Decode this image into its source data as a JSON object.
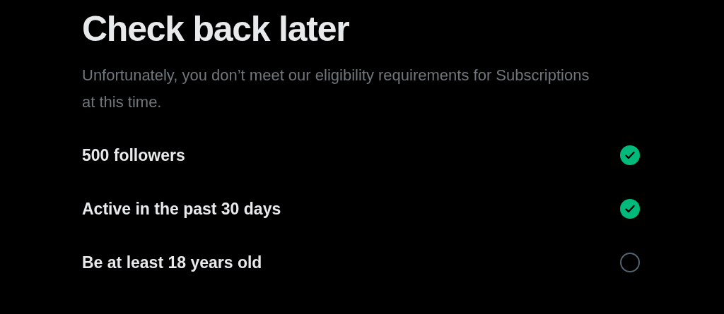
{
  "title": "Check back later",
  "description": "Unfortunately, you don’t meet our eligibility requirements for Subscriptions at this time.",
  "requirements": [
    {
      "label": "500 followers",
      "checked": true
    },
    {
      "label": "Active in the past 30 days",
      "checked": true
    },
    {
      "label": "Be at least 18 years old",
      "checked": false
    }
  ]
}
